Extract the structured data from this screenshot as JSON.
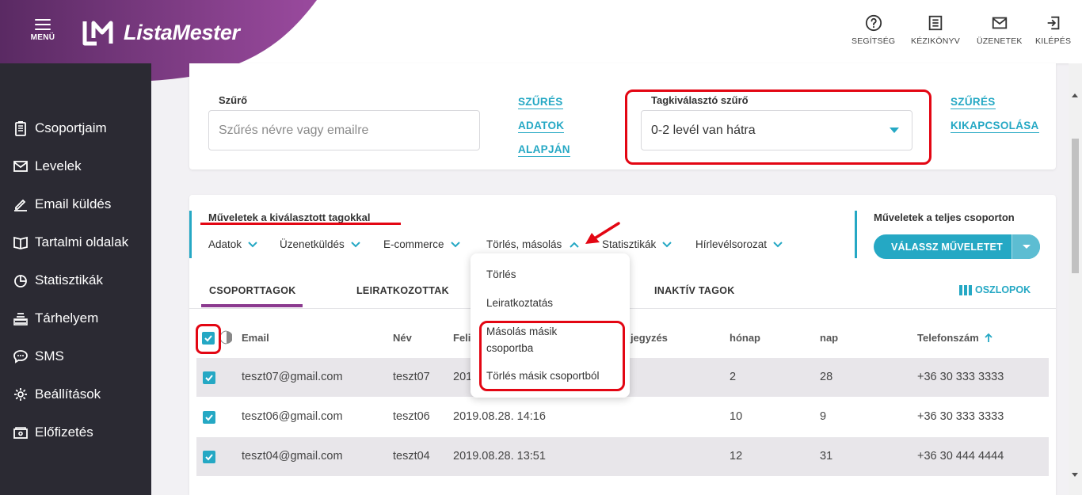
{
  "header": {
    "menu_label": "MENÜ",
    "logo_text": "ListaMester",
    "nav": [
      {
        "label": "SEGÍTSÉG",
        "icon": "help-icon"
      },
      {
        "label": "KÉZIKÖNYV",
        "icon": "manual-icon"
      },
      {
        "label": "ÜZENETEK",
        "icon": "mail-icon"
      },
      {
        "label": "KILÉPÉS",
        "icon": "logout-icon"
      }
    ]
  },
  "sidebar": {
    "items": [
      {
        "label": "Csoportjaim",
        "icon": "clipboard-icon"
      },
      {
        "label": "Levelek",
        "icon": "envelope-icon"
      },
      {
        "label": "Email küldés",
        "icon": "pencil-icon"
      },
      {
        "label": "Tartalmi oldalak",
        "icon": "book-icon"
      },
      {
        "label": "Statisztikák",
        "icon": "pie-chart-icon"
      },
      {
        "label": "Tárhelyem",
        "icon": "storage-icon"
      },
      {
        "label": "SMS",
        "icon": "chat-icon"
      },
      {
        "label": "Beállítások",
        "icon": "gear-icon"
      },
      {
        "label": "Előfizetés",
        "icon": "wallet-icon"
      }
    ]
  },
  "filter": {
    "label": "Szűrő",
    "placeholder": "Szűrés névre vagy emailre",
    "data_filter_links": [
      "SZŰRÉS",
      "ADATOK",
      "ALAPJÁN"
    ],
    "member_filter_label": "Tagkiválasztó szűrő",
    "member_filter_value": "0-2 levél van hátra",
    "disable_links": [
      "SZŰRÉS",
      "KIKAPCSOLÁSA"
    ]
  },
  "operations": {
    "selected_title": "Műveletek a kiválasztott tagokkal",
    "menu": [
      "Adatok",
      "Üzenetküldés",
      "E-commerce",
      "Törlés, másolás",
      "Statisztikák",
      "Hírlevélsorozat"
    ],
    "group_title": "Műveletek a teljes csoporton",
    "group_button": "VÁLASSZ MŰVELETET"
  },
  "dropdown": {
    "items": [
      "Törlés",
      "Leiratkoztatás",
      "Másolás másik",
      "csoportba",
      "Törlés másik csoportból"
    ]
  },
  "tabs": {
    "items": [
      "CSOPORTTAGOK",
      "LEIRATKOZOTTAK",
      "INAKTÍV TAGOK"
    ],
    "columns_label": "OSZLOPOK"
  },
  "table": {
    "headers": [
      "Email",
      "Név",
      "Feli",
      "gjegyzés",
      "hónap",
      "nap",
      "Telefonszám"
    ],
    "rows": [
      {
        "email": "teszt07@gmail.com",
        "name": "teszt07",
        "date": "201",
        "month": "2",
        "day": "28",
        "phone": "+36 30 333 3333"
      },
      {
        "email": "teszt06@gmail.com",
        "name": "teszt06",
        "date": "2019.08.28. 14:16",
        "month": "10",
        "day": "9",
        "phone": "+36 30 333 3333"
      },
      {
        "email": "teszt04@gmail.com",
        "name": "teszt04",
        "date": "2019.08.28. 13:51",
        "month": "12",
        "day": "31",
        "phone": "+36 30 444 4444"
      }
    ]
  },
  "colors": {
    "accent": "#25a8c4",
    "brand_purple": "#8b3a8f",
    "sidebar_bg": "#2b2a33",
    "annotation_red": "#e30613"
  }
}
